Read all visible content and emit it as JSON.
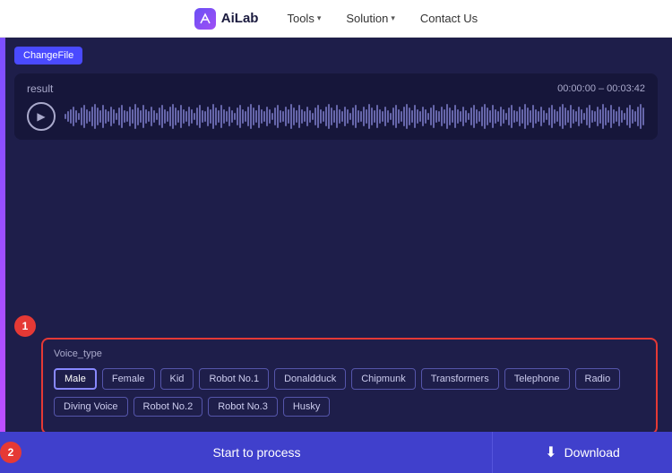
{
  "header": {
    "logo_icon": "AI",
    "logo_text": "AiLab",
    "nav_items": [
      {
        "label": "Tools",
        "has_dropdown": true
      },
      {
        "label": "Solution",
        "has_dropdown": true
      },
      {
        "label": "Contact Us",
        "has_dropdown": false
      }
    ]
  },
  "toolbar": {
    "change_file_label": "ChangeFile"
  },
  "result_panel": {
    "label": "result",
    "time_range": "00:00:00 – 00:03:42"
  },
  "steps": {
    "step1_number": "1",
    "step2_number": "2"
  },
  "voice_type": {
    "label": "Voice_type",
    "buttons_row1": [
      {
        "label": "Male",
        "active": true
      },
      {
        "label": "Female",
        "active": false
      },
      {
        "label": "Kid",
        "active": false
      },
      {
        "label": "Robot No.1",
        "active": false
      },
      {
        "label": "Donaldduck",
        "active": false
      },
      {
        "label": "Chipmunk",
        "active": false
      },
      {
        "label": "Transformers",
        "active": false
      },
      {
        "label": "Telephone",
        "active": false
      },
      {
        "label": "Radio",
        "active": false
      }
    ],
    "buttons_row2": [
      {
        "label": "Diving Voice",
        "active": false
      },
      {
        "label": "Robot No.2",
        "active": false
      },
      {
        "label": "Robot No.3",
        "active": false
      },
      {
        "label": "Husky",
        "active": false
      }
    ]
  },
  "bottom_bar": {
    "start_label": "Start to process",
    "download_label": "Download"
  },
  "waveform": {
    "bars": [
      2,
      4,
      6,
      8,
      5,
      3,
      7,
      9,
      6,
      4,
      8,
      10,
      7,
      5,
      9,
      6,
      4,
      8,
      6,
      3,
      7,
      9,
      5,
      4,
      8,
      6,
      10,
      7,
      5,
      9,
      6,
      4,
      8,
      5,
      3,
      7,
      9,
      6,
      4,
      8,
      10,
      7,
      5,
      9,
      6,
      4,
      8,
      6,
      3,
      7,
      9,
      5,
      4,
      8,
      6,
      10,
      7,
      5,
      9,
      6,
      4,
      8,
      5,
      3,
      7,
      9,
      6,
      4,
      8,
      10,
      7,
      5,
      9,
      6,
      4,
      8,
      6,
      3,
      7,
      9,
      5,
      4,
      8,
      6,
      10,
      7,
      5,
      9,
      6,
      4,
      8,
      5,
      3,
      7,
      9,
      6,
      4,
      8,
      10,
      7,
      5,
      9,
      6,
      4,
      8,
      6,
      3,
      7,
      9,
      5,
      4,
      8,
      6,
      10,
      7,
      5,
      9,
      6,
      4,
      8,
      5,
      3,
      7,
      9,
      6,
      4,
      8,
      10,
      7,
      5,
      9,
      6,
      4,
      8,
      6,
      3,
      7,
      9,
      5,
      4,
      8,
      6,
      10,
      7,
      5,
      9,
      6,
      4,
      8,
      5,
      3,
      7,
      9,
      6,
      4,
      8,
      10,
      7,
      5,
      9,
      6,
      4,
      8,
      6,
      3,
      7,
      9,
      5,
      4,
      8,
      6,
      10,
      7,
      5,
      9,
      6,
      4,
      8,
      5,
      3,
      7,
      9,
      6,
      4,
      8,
      10,
      7,
      5,
      9,
      6,
      4,
      8,
      6,
      3,
      7,
      9,
      5,
      4,
      8,
      6,
      10,
      7,
      5,
      9,
      6,
      4,
      8,
      5,
      3,
      7,
      9,
      6,
      4,
      8,
      10,
      7,
      5,
      9,
      6,
      4,
      8,
      6,
      3,
      7,
      9,
      5,
      4,
      8,
      6,
      10,
      7,
      5,
      9
    ]
  }
}
